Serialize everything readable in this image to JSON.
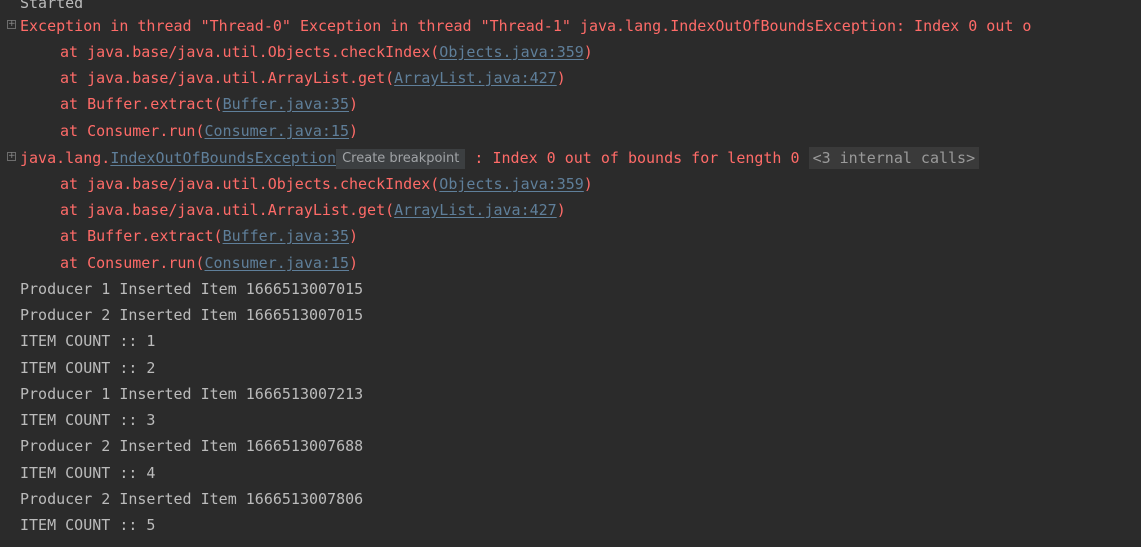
{
  "console": {
    "started_line": "Started",
    "exception_header": "Exception in thread \"Thread-0\" Exception in thread \"Thread-1\" java.lang.IndexOutOfBoundsException: Index 0 out o",
    "trace1": [
      {
        "prefix": "at java.base/java.util.Objects.checkIndex(",
        "link": "Objects.java:359",
        "suffix": ")"
      },
      {
        "prefix": "at java.base/java.util.ArrayList.get(",
        "link": "ArrayList.java:427",
        "suffix": ")"
      },
      {
        "prefix": "at Buffer.extract(",
        "link": "Buffer.java:35",
        "suffix": ")"
      },
      {
        "prefix": "at Consumer.run(",
        "link": "Consumer.java:15",
        "suffix": ")"
      }
    ],
    "exception2": {
      "package": "java.lang.",
      "class_link": "IndexOutOfBoundsException",
      "tooltip": "Create breakpoint",
      "message": " : Index 0 out of bounds for length 0 ",
      "internal_calls": "<3 internal calls>"
    },
    "trace2": [
      {
        "prefix": "at java.base/java.util.Objects.checkIndex(",
        "link": "Objects.java:359",
        "suffix": ")"
      },
      {
        "prefix": "at java.base/java.util.ArrayList.get(",
        "link": "ArrayList.java:427",
        "suffix": ")"
      },
      {
        "prefix": "at Buffer.extract(",
        "link": "Buffer.java:35",
        "suffix": ")"
      },
      {
        "prefix": "at Consumer.run(",
        "link": "Consumer.java:15",
        "suffix": ")"
      }
    ],
    "output": [
      "Producer 1 Inserted Item 1666513007015",
      "Producer 2 Inserted Item 1666513007015",
      "ITEM COUNT :: 1",
      "ITEM COUNT :: 2",
      "Producer 1 Inserted Item 1666513007213",
      "ITEM COUNT :: 3",
      "Producer 2 Inserted Item 1666513007688",
      "ITEM COUNT :: 4",
      "Producer 2 Inserted Item 1666513007806",
      "ITEM COUNT :: 5"
    ],
    "fold_glyph": "+"
  },
  "colors": {
    "background": "#2b2b2b",
    "error": "#ff6b68",
    "output": "#bbbbbb",
    "link": "#5f7f9a"
  }
}
